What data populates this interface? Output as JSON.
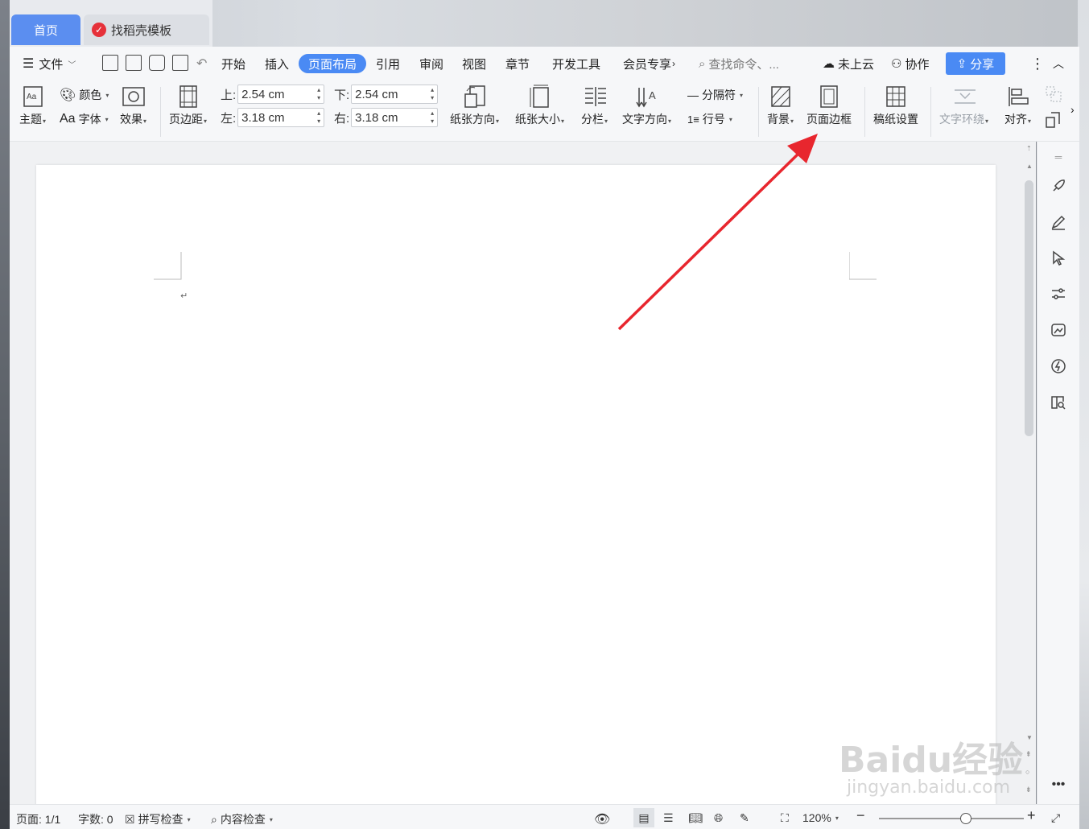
{
  "tabs": {
    "home": "首页",
    "template": "找稻壳模板"
  },
  "menu": {
    "file": "文件",
    "items": [
      "开始",
      "插入",
      "页面布局",
      "引用",
      "审阅",
      "视图",
      "章节",
      "开发工具",
      "会员专享"
    ],
    "active": "页面布局",
    "search_placeholder": "查找命令、...",
    "cloud": "未上云",
    "collab": "协作",
    "share": "分享"
  },
  "toolbar": {
    "theme": "主题",
    "color": "颜色",
    "font": "字体",
    "effect": "效果",
    "margins": "页边距",
    "top_label": "上:",
    "top_value": "2.54 cm",
    "bottom_label": "下:",
    "bottom_value": "2.54 cm",
    "left_label": "左:",
    "left_value": "3.18 cm",
    "right_label": "右:",
    "right_value": "3.18 cm",
    "orientation": "纸张方向",
    "size": "纸张大小",
    "columns": "分栏",
    "text_direction": "文字方向",
    "breaks": "分隔符",
    "line_numbers": "行号",
    "background": "背景",
    "page_border": "页面边框",
    "draft_paper": "稿纸设置",
    "text_wrap": "文字环绕",
    "align": "对齐"
  },
  "document": {
    "paragraph_mark": "↵"
  },
  "status": {
    "page": "页面: 1/1",
    "words": "字数: 0",
    "spell": "拼写检查",
    "content_check": "内容检查",
    "zoom": "120%",
    "zoom_level": 0.6
  },
  "watermark": {
    "main": "Baidu经验",
    "sub": "jingyan.baidu.com"
  },
  "colors": {
    "accent": "#4a8af4",
    "arrow": "#e8262e"
  }
}
